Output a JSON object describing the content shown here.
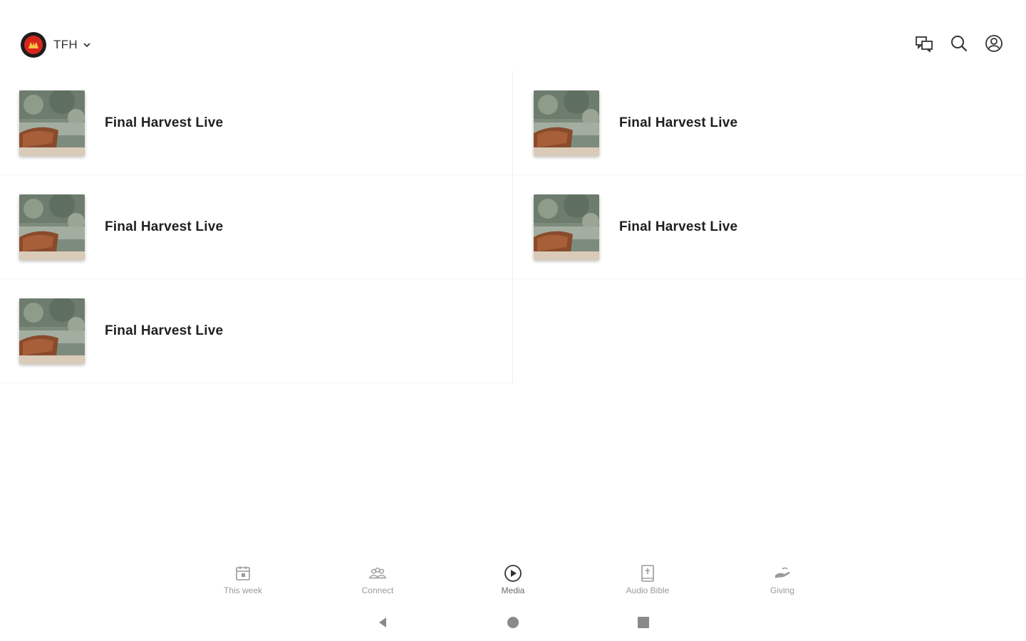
{
  "header": {
    "brand_name": "TFH",
    "actions": [
      {
        "icon": "chat-icon"
      },
      {
        "icon": "search-icon"
      },
      {
        "icon": "account-icon"
      }
    ]
  },
  "media_items": {
    "left": [
      {
        "title": "Final Harvest Live"
      },
      {
        "title": "Final Harvest Live"
      },
      {
        "title": "Final Harvest Live"
      }
    ],
    "right": [
      {
        "title": "Final Harvest Live"
      },
      {
        "title": "Final Harvest Live"
      }
    ]
  },
  "tabs": [
    {
      "label": "This week",
      "icon": "calendar-icon"
    },
    {
      "label": "Connect",
      "icon": "people-icon"
    },
    {
      "label": "Media",
      "icon": "play-icon",
      "active": true
    },
    {
      "label": "Audio Bible",
      "icon": "bible-icon"
    },
    {
      "label": "Giving",
      "icon": "giving-hand-icon"
    }
  ],
  "colors": {
    "brand_red": "#d8261c",
    "text_primary": "#1f1f1f",
    "tab_label": "#9a9a9a"
  }
}
